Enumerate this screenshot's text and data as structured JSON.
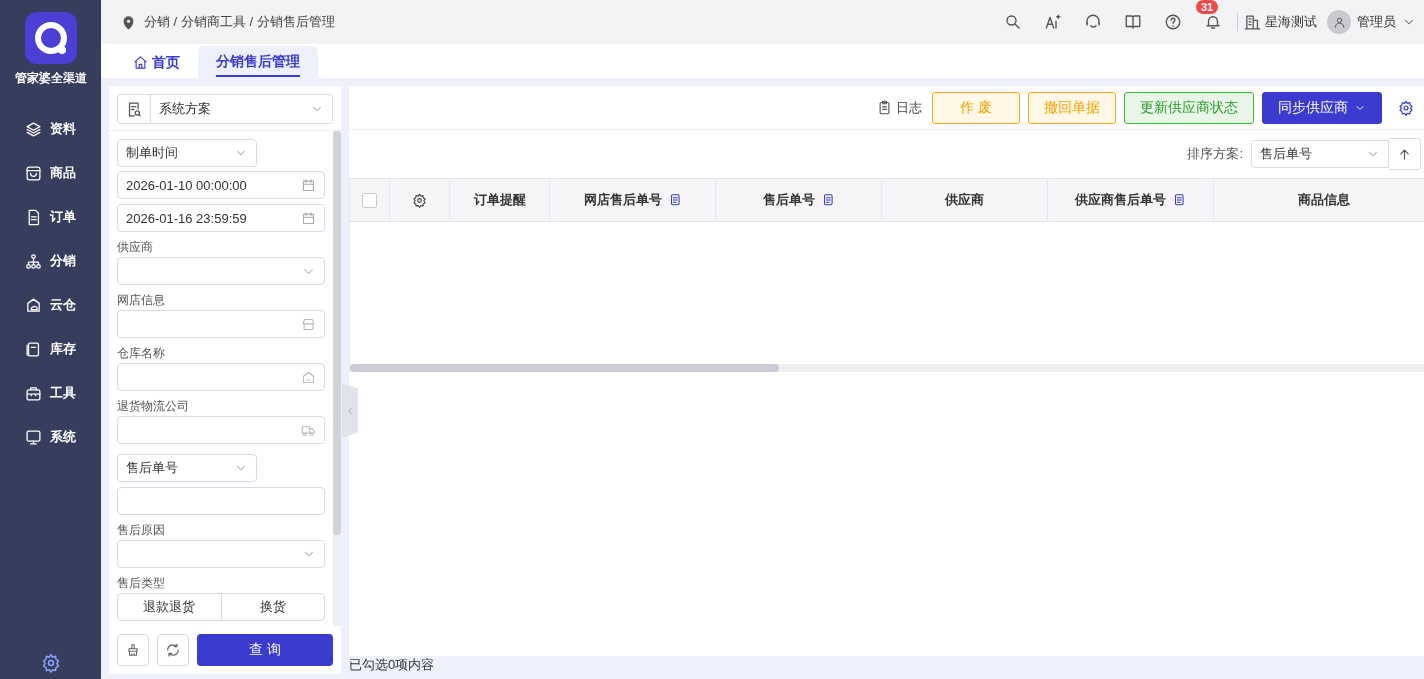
{
  "sidebar": {
    "logo_text": "管家婆全渠道",
    "items": [
      {
        "label": "资料"
      },
      {
        "label": "商品"
      },
      {
        "label": "订单"
      },
      {
        "label": "分销"
      },
      {
        "label": "云仓"
      },
      {
        "label": "库存"
      },
      {
        "label": "工具"
      },
      {
        "label": "系统"
      }
    ]
  },
  "header": {
    "breadcrumb": "分销 / 分销商工具 / 分销售后管理",
    "notification_count": "31",
    "company": "星海测试",
    "user": "管理员"
  },
  "tabs": [
    {
      "label": "首页",
      "selected": false
    },
    {
      "label": "分销售后管理",
      "selected": true
    }
  ],
  "filter": {
    "scheme": "系统方案",
    "date_type": "制单时间",
    "date_from": "2026-01-10 00:00:00",
    "date_to": "2026-01-16 23:59:59",
    "fields": [
      {
        "label": "供应商",
        "kind": "select"
      },
      {
        "label": "网店信息",
        "kind": "shop"
      },
      {
        "label": "仓库名称",
        "kind": "warehouse"
      },
      {
        "label": "退货物流公司",
        "kind": "truck"
      }
    ],
    "number_type": "售后单号",
    "reason_label": "售后原因",
    "type_label": "售后类型",
    "type_options": [
      {
        "label": "退款退货",
        "selected": false
      },
      {
        "label": "换货",
        "selected": false
      }
    ],
    "query_button": "查 询"
  },
  "toolbar": {
    "log": "日志",
    "buttons": [
      {
        "label": "作 废",
        "kind": "warning"
      },
      {
        "label": "撤回单据",
        "kind": "warning"
      },
      {
        "label": "更新供应商状态",
        "kind": "success"
      },
      {
        "label": "同步供应商",
        "kind": "primary"
      }
    ]
  },
  "sort": {
    "label": "排序方案:",
    "value": "售后单号"
  },
  "table": {
    "select_all": {
      "checked": false
    },
    "columns": [
      {
        "label": "订单提醒",
        "copyable": false
      },
      {
        "label": "网店售后单号",
        "copyable": true
      },
      {
        "label": "售后单号",
        "copyable": true
      },
      {
        "label": "供应商",
        "copyable": false
      },
      {
        "label": "供应商售后单号",
        "copyable": true
      },
      {
        "label": "商品信息",
        "copyable": false
      }
    ]
  },
  "footer": "已勾选0项内容"
}
